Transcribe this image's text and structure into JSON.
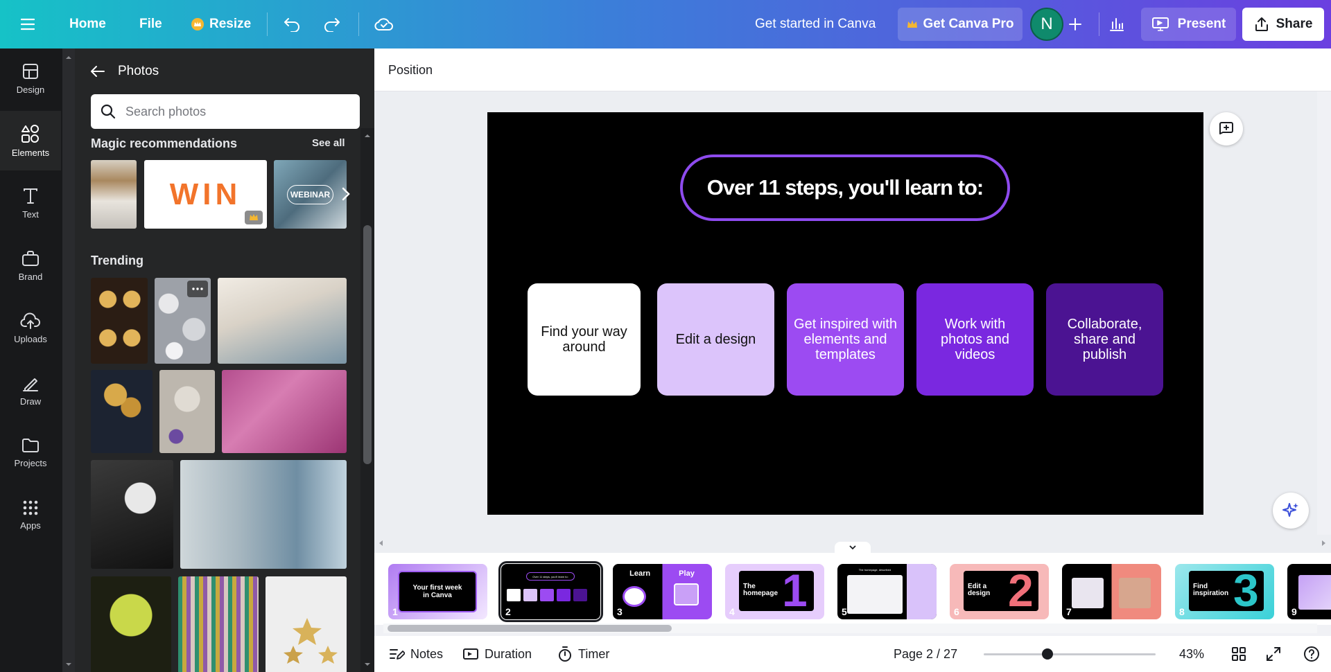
{
  "topbar": {
    "home": "Home",
    "file": "File",
    "resize": "Resize",
    "get_started": "Get started in Canva",
    "get_pro": "Get Canva Pro",
    "avatar_initial": "N",
    "present": "Present",
    "share": "Share"
  },
  "rail": {
    "items": [
      {
        "label": "Design",
        "icon": "layout-icon"
      },
      {
        "label": "Elements",
        "icon": "shapes-icon"
      },
      {
        "label": "Text",
        "icon": "text-icon"
      },
      {
        "label": "Brand",
        "icon": "briefcase-icon"
      },
      {
        "label": "Uploads",
        "icon": "upload-cloud-icon"
      },
      {
        "label": "Draw",
        "icon": "pen-icon"
      },
      {
        "label": "Projects",
        "icon": "folder-icon"
      },
      {
        "label": "Apps",
        "icon": "grid-icon"
      }
    ]
  },
  "panel": {
    "title": "Photos",
    "search_placeholder": "Search photos",
    "magic_title": "Magic recommendations",
    "see_all": "See all",
    "win_text": "WIN",
    "webinar_text": "WEBINAR",
    "trending_title": "Trending"
  },
  "editor": {
    "position_label": "Position"
  },
  "slide": {
    "title": "Over 11 steps, you'll learn to:",
    "cards": [
      {
        "text": "Find your way around",
        "bg": "#ffffff",
        "fg": "#111111"
      },
      {
        "text": "Edit a design",
        "bg": "#dcc4fb",
        "fg": "#111111"
      },
      {
        "text": "Get inspired with elements and templates",
        "bg": "#9c4bf2",
        "fg": "#ffffff"
      },
      {
        "text": "Work with photos and videos",
        "bg": "#7a28e0",
        "fg": "#ffffff"
      },
      {
        "text": "Collaborate, share and publish",
        "bg": "#4b1392",
        "fg": "#ffffff"
      }
    ]
  },
  "filmstrip": {
    "pages": [
      {
        "num": "1",
        "label": "Your first week in Canva"
      },
      {
        "num": "2",
        "label": "Over 11 steps, you'll learn to:"
      },
      {
        "num": "3",
        "label": "Learn Play"
      },
      {
        "num": "4",
        "label": "The homepage",
        "big": "1"
      },
      {
        "num": "5",
        "label": "The homepage, described"
      },
      {
        "num": "6",
        "label": "Edit a design",
        "big": "2"
      },
      {
        "num": "7",
        "label": ""
      },
      {
        "num": "8",
        "label": "Find inspiration",
        "big": "3"
      },
      {
        "num": "9",
        "label": ""
      }
    ]
  },
  "footer": {
    "notes": "Notes",
    "duration": "Duration",
    "timer": "Timer",
    "page": "Page 2 / 27",
    "zoom": "43%",
    "zoom_fraction": 0.37
  },
  "colors": {
    "accent_purple": "#8e4bee",
    "canvas_bg": "#eceef2",
    "avatar": "#0f8a6c"
  }
}
